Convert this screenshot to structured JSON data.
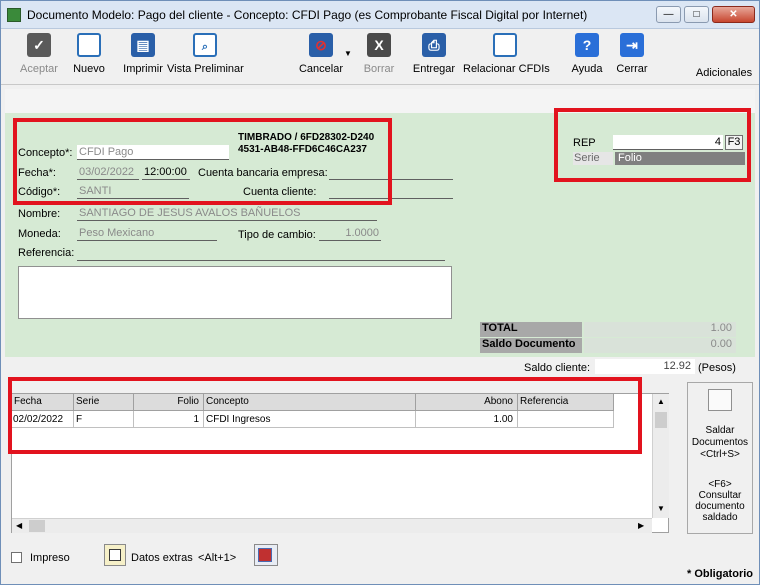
{
  "window": {
    "title": "Documento Modelo: Pago del cliente - Concepto: CFDI Pago (es Comprobante Fiscal Digital por Internet)",
    "buttons": {
      "minimize": "—",
      "maximize": "□",
      "close": "✕"
    }
  },
  "toolbar": {
    "aceptar": "Aceptar",
    "nuevo": "Nuevo",
    "imprimir": "Imprimir",
    "vista": "Vista Preliminar",
    "cancelar": "Cancelar",
    "borrar": "Borrar",
    "entregar": "Entregar",
    "relacionar": "Relacionar CFDIs",
    "ayuda": "Ayuda",
    "cerrar": "Cerrar",
    "adicionales": "Adicionales"
  },
  "form": {
    "concepto_label": "Concepto*:",
    "concepto_value": "CFDI Pago",
    "timbrado_line1": "TIMBRADO / 6FD28302-D240",
    "timbrado_line2": "4531-AB48-FFD6C46CA237",
    "fecha_label": "Fecha*:",
    "fecha_value": "03/02/2022",
    "hora_value": "12:00:00",
    "cuenta_bancaria_label": "Cuenta bancaria empresa:",
    "codigo_label": "Código*:",
    "codigo_value": "SANTI",
    "cuenta_cliente_label": "Cuenta cliente:",
    "nombre_label": "Nombre:",
    "nombre_value": "SANTIAGO DE JESUS AVALOS BAÑUELOS",
    "moneda_label": "Moneda:",
    "moneda_value": "Peso Mexicano",
    "tipo_cambio_label": "Tipo de cambio:",
    "tipo_cambio_value": "1.0000",
    "referencia_label": "Referencia:"
  },
  "rep": {
    "label": "REP",
    "value": "4",
    "f3": "F3",
    "serie_label": "Serie",
    "folio_label": "Folio"
  },
  "totals": {
    "total_label": "TOTAL",
    "total_value": "1.00",
    "saldo_doc_label": "Saldo Documento",
    "saldo_doc_value": "0.00",
    "saldo_cliente_label": "Saldo cliente:",
    "saldo_cliente_value": "12.92",
    "saldo_cliente_unit": "(Pesos)"
  },
  "grid": {
    "headers": [
      "Fecha",
      "Serie",
      "Folio",
      "Concepto",
      "Abono",
      "Referencia"
    ],
    "rows": [
      {
        "fecha": "02/02/2022",
        "serie": "F",
        "folio": "1",
        "concepto": "CFDI Ingresos",
        "abono": "1.00",
        "referencia": ""
      }
    ]
  },
  "side": {
    "saldar_line1": "Saldar",
    "saldar_line2": "Documentos",
    "saldar_line3": "<Ctrl+S>",
    "f6": "<F6>",
    "consultar_line1": "Consultar",
    "consultar_line2": "documento",
    "consultar_line3": "saldado"
  },
  "footer": {
    "impreso": "Impreso",
    "datos_extras": "Datos extras",
    "datos_extras_key": "<Alt+1>",
    "obligatorio": "* Obligatorio"
  },
  "colors": {
    "form_bg": "#d6ead4",
    "highlight": "#e2131e",
    "folio_bg": "#808080"
  }
}
